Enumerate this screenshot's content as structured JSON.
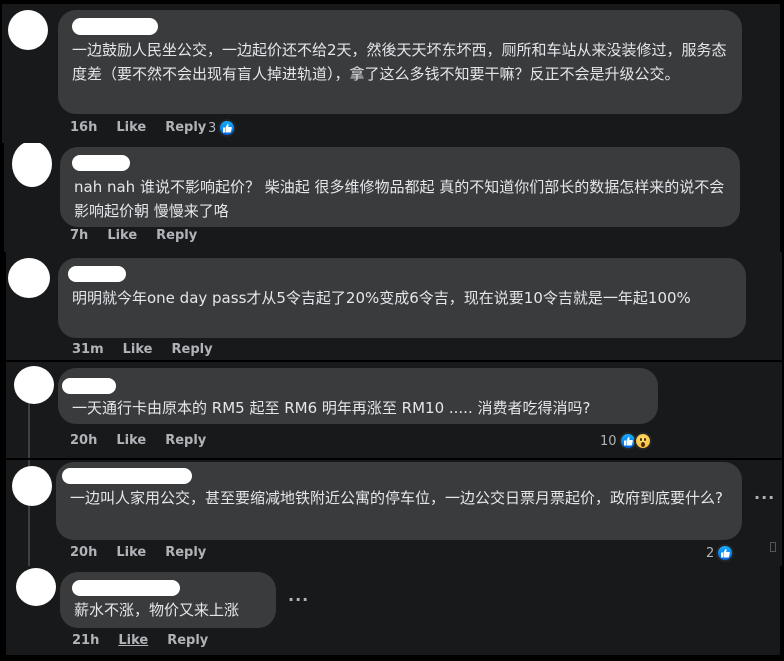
{
  "comments": [
    {
      "text": "一边鼓励人民坐公交，一边起价还不给2天，然後天天坏东坏西，厕所和车站从来没装修过，服务态度差（要不然不会出现有盲人掉进轨道），拿了这么多钱不知要干嘛？反正不会是升级公交。",
      "time": "16h",
      "like_label": "Like",
      "reply_label": "Reply",
      "reaction_count": "3",
      "reaction_icons": [
        "like-icon"
      ]
    },
    {
      "text": "nah nah 谁说不影响起价？ 柴油起 很多维修物品都起 真的不知道你们部长的数据怎样来的说不会影响起价朝 慢慢来了咯",
      "time": "7h",
      "like_label": "Like",
      "reply_label": "Reply"
    },
    {
      "text": "明明就今年one day pass才从5令吉起了20%变成6令吉，现在说要10令吉就是一年起100%",
      "time": "31m",
      "like_label": "Like",
      "reply_label": "Reply"
    },
    {
      "text": "一天通行卡由原本的 RM5 起至 RM6 明年再涨至 RM10 ..... 消费者吃得消吗?",
      "time": "20h",
      "like_label": "Like",
      "reply_label": "Reply",
      "reaction_count": "10",
      "reaction_icons": [
        "like-icon",
        "wow-icon"
      ]
    },
    {
      "text": "一边叫人家用公交，甚至要缩减地铁附近公寓的停车位，一边公交日票月票起价，政府到底要什么?",
      "time": "20h",
      "like_label": "Like",
      "reply_label": "Reply",
      "reaction_count": "2",
      "reaction_icons": [
        "like-icon"
      ],
      "more_label": "···"
    },
    {
      "text": "薪水不涨，物价又来上涨",
      "time": "21h",
      "like_label": "Like",
      "reply_label": "Reply",
      "more_label": "···"
    }
  ],
  "colors": {
    "background": "#18191a",
    "bubble": "#3a3b3c",
    "text": "#e4e6eb",
    "meta": "#b0b3b8",
    "like_blue": "#1877f2"
  }
}
